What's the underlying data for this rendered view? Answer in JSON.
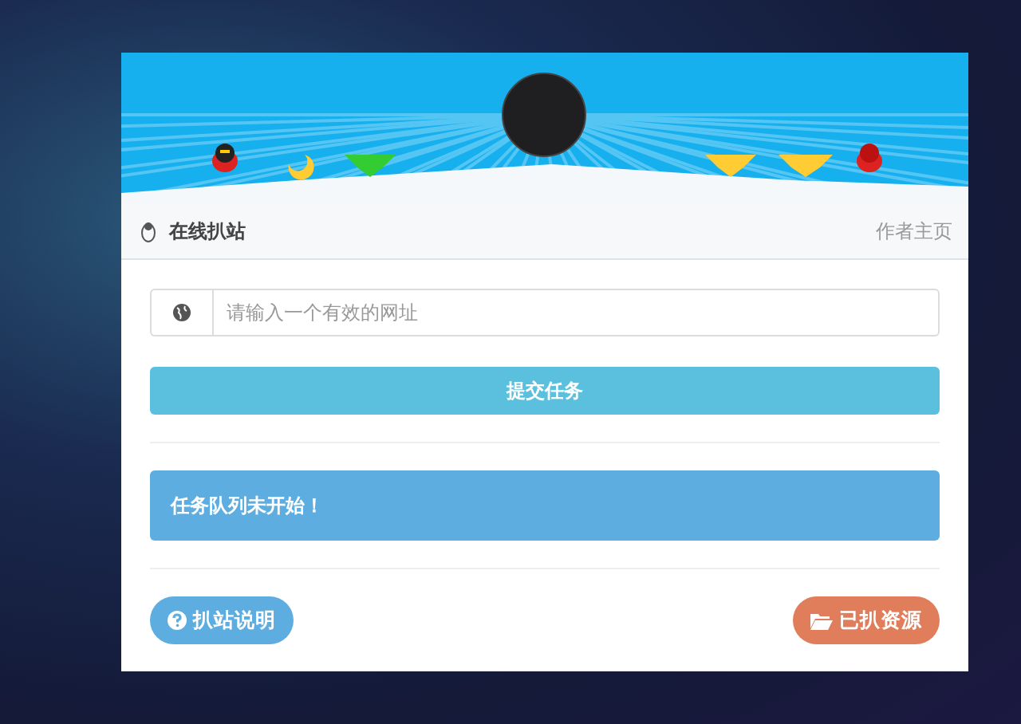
{
  "panel": {
    "title": "在线扒站",
    "author_link": "作者主页"
  },
  "url_field": {
    "placeholder": "请输入一个有效的网址"
  },
  "submit_button": "提交任务",
  "status_message": "任务队列未开始！",
  "footer_buttons": [
    {
      "kind": "help",
      "label": "扒站说明"
    },
    {
      "kind": "folder",
      "label": "已扒资源"
    }
  ]
}
